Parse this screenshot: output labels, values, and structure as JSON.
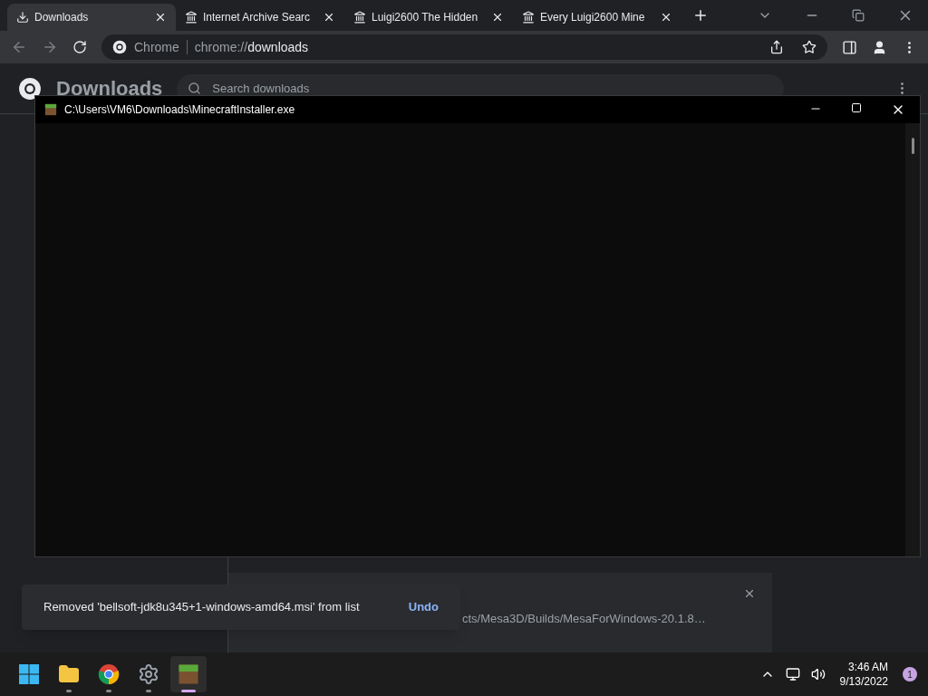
{
  "browser": {
    "tabs": [
      {
        "kind": "download",
        "title": "Downloads",
        "selected": true
      },
      {
        "kind": "archive",
        "title": "Internet Archive Searc",
        "selected": false
      },
      {
        "kind": "archive",
        "title": "Luigi2600 The Hidden",
        "selected": false
      },
      {
        "kind": "archive",
        "title": "Every Luigi2600 Mine",
        "selected": false
      }
    ],
    "omnibox": {
      "site_label": "Chrome",
      "url_prefix": "chrome://",
      "url_host": "downloads"
    }
  },
  "downloads_page": {
    "title": "Downloads",
    "search_placeholder": "Search downloads",
    "item_path": "cts/Mesa3D/Builds/MesaForWindows-20.1.8…"
  },
  "console_window": {
    "title": "C:\\Users\\VM6\\Downloads\\MinecraftInstaller.exe"
  },
  "toast": {
    "message": "Removed 'bellsoft-jdk8u345+1-windows-amd64.msi' from list",
    "action": "Undo"
  },
  "taskbar": {
    "apps": [
      {
        "kind": "start",
        "active": false
      },
      {
        "kind": "explorer",
        "active": false
      },
      {
        "kind": "chrome",
        "active": false
      },
      {
        "kind": "settings",
        "active": false
      },
      {
        "kind": "minecraft",
        "active": true
      }
    ],
    "time": "3:46 AM",
    "date": "9/13/2022",
    "notification_count": "1"
  }
}
